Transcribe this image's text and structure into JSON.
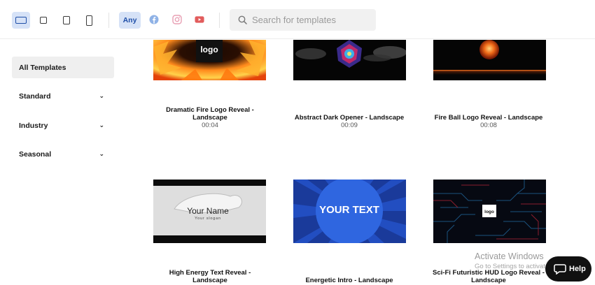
{
  "toolbar": {
    "aspect_buttons": [
      {
        "name": "landscape",
        "active": true
      },
      {
        "name": "square",
        "active": false
      },
      {
        "name": "portrait-4-5",
        "active": false
      },
      {
        "name": "vertical",
        "active": false
      }
    ],
    "platform_any_label": "Any",
    "platform_icons": [
      "facebook-icon",
      "instagram-icon",
      "youtube-icon"
    ],
    "search_placeholder": "Search for templates"
  },
  "sidebar": {
    "items": [
      {
        "label": "All Templates",
        "active": true,
        "expandable": false
      },
      {
        "label": "Standard",
        "active": false,
        "expandable": true
      },
      {
        "label": "Industry",
        "active": false,
        "expandable": true
      },
      {
        "label": "Seasonal",
        "active": false,
        "expandable": true
      }
    ]
  },
  "templates": [
    {
      "title_line1": "Dramatic Fire Logo Reveal -",
      "title_line2": "Landscape",
      "duration": "00:04",
      "thumb_text": "logo"
    },
    {
      "title_line1": "Abstract Dark Opener - Landscape",
      "title_line2": "",
      "duration": "00:09",
      "thumb_text": ""
    },
    {
      "title_line1": "Fire Ball Logo Reveal - Landscape",
      "title_line2": "",
      "duration": "00:08",
      "thumb_text": ""
    },
    {
      "title_line1": "High Energy Text Reveal -",
      "title_line2": "Landscape",
      "duration": "",
      "thumb_text": "Your Name",
      "thumb_subtext": "Your slogan"
    },
    {
      "title_line1": "Energetic Intro - Landscape",
      "title_line2": "",
      "duration": "",
      "thumb_text": "YOUR TEXT"
    },
    {
      "title_line1": "Sci-Fi Futuristic HUD Logo Reveal -",
      "title_line2": "Landscape",
      "duration": "",
      "thumb_text": "logo"
    }
  ],
  "watermark": {
    "line1": "Activate Windows",
    "line2": "Go to Settings to activate Windows."
  },
  "help_label": "Help",
  "colors": {
    "accent": "#1f4fa8",
    "accent_bg": "#d6e2f7",
    "facebook": "#8fb2e6",
    "instagram": "#e8a0b4",
    "youtube": "#e25c5c"
  }
}
